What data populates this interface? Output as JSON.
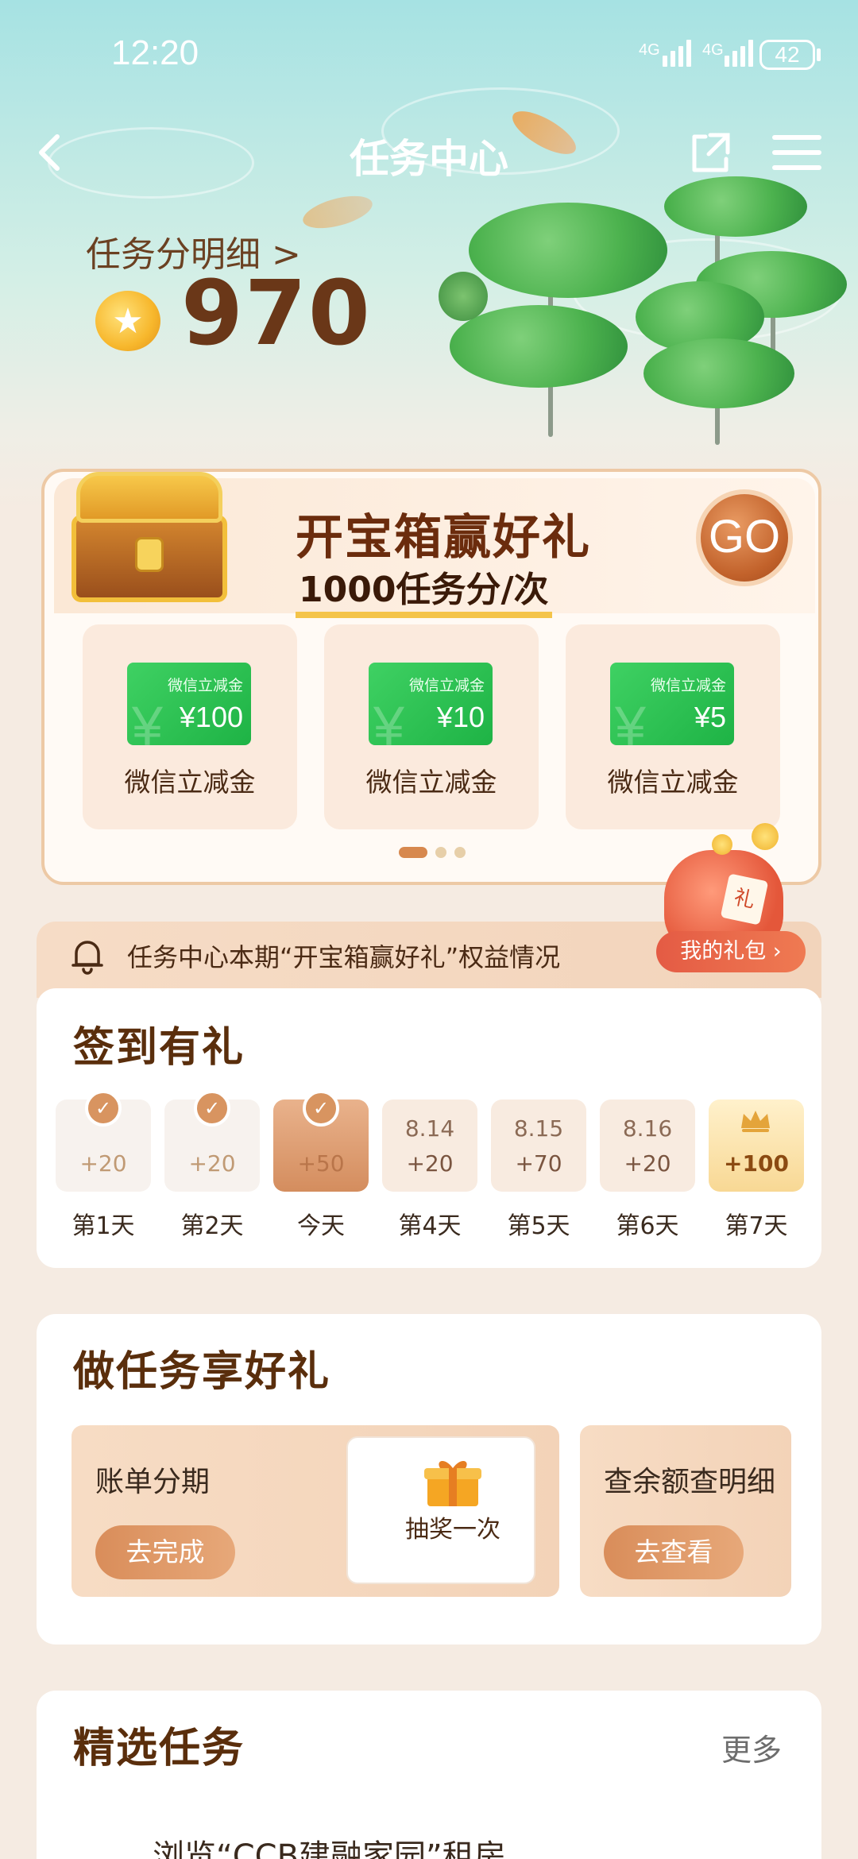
{
  "status_bar": {
    "time": "12:20",
    "network1": "4G",
    "network2": "4G",
    "battery": "42"
  },
  "nav": {
    "title": "任务中心"
  },
  "points": {
    "label": "任务分明细  >",
    "value": "970"
  },
  "treasure": {
    "title": "开宝箱赢好礼",
    "subtitle": "1000任务分/次",
    "go_label": "GO",
    "prizes": [
      {
        "coupon_title": "微信立减金",
        "coupon_value": "¥100",
        "name": "微信立减金"
      },
      {
        "coupon_title": "微信立减金",
        "coupon_value": "¥10",
        "name": "微信立减金"
      },
      {
        "coupon_title": "微信立减金",
        "coupon_value": "¥5",
        "name": "微信立减金"
      }
    ],
    "bag_tag": "礼"
  },
  "notice": {
    "text": "任务中心本期“开宝箱赢好礼”权益情况",
    "gift_link": "我的礼包 ›"
  },
  "signin": {
    "title": "签到有礼",
    "days": [
      {
        "date": "",
        "points": "+20",
        "label": "第1天",
        "state": "done"
      },
      {
        "date": "",
        "points": "+20",
        "label": "第2天",
        "state": "done"
      },
      {
        "date": "",
        "points": "+50",
        "label": "今天",
        "state": "today"
      },
      {
        "date": "8.14",
        "points": "+20",
        "label": "第4天",
        "state": "future"
      },
      {
        "date": "8.15",
        "points": "+70",
        "label": "第5天",
        "state": "future"
      },
      {
        "date": "8.16",
        "points": "+20",
        "label": "第6天",
        "state": "future"
      },
      {
        "date": "",
        "points": "+100",
        "label": "第7天",
        "state": "final"
      }
    ]
  },
  "tasks": {
    "title": "做任务享好礼",
    "items": [
      {
        "name": "账单分期",
        "button": "去完成",
        "reward": "抽奖一次"
      },
      {
        "name": "查余额查明细",
        "button": "去查看"
      }
    ]
  },
  "featured": {
    "title": "精选任务",
    "more": "更多",
    "first_task": "浏览“CCB建融家园”租房"
  },
  "colors": {
    "hero_top": "#a6e2e3",
    "page_bg": "#f5ebe2",
    "accent_brown": "#6a3718",
    "accent_orange": "#d98d5a",
    "coupon_green": "#1eb345"
  }
}
